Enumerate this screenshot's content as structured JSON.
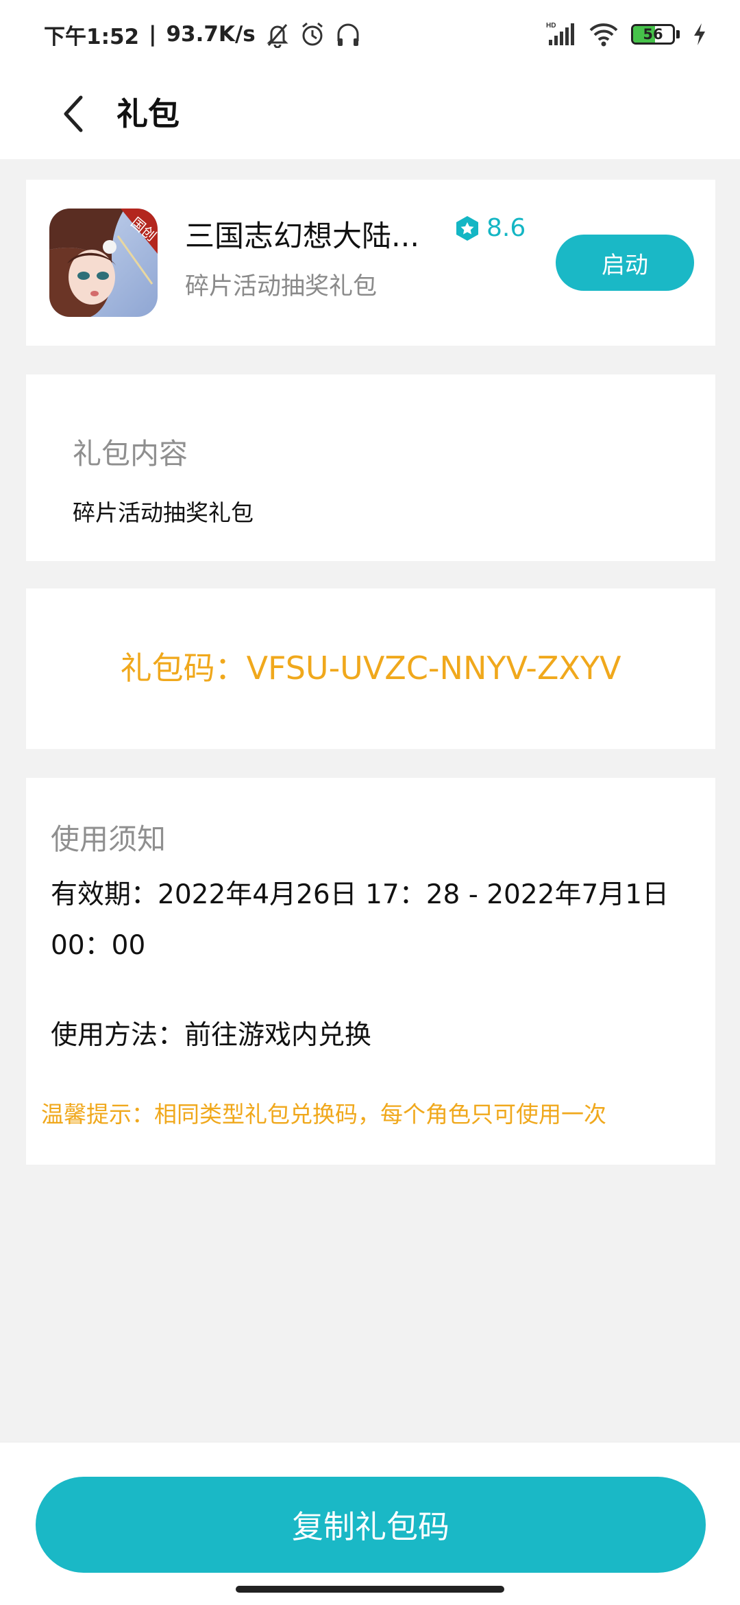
{
  "status_bar": {
    "time": "下午1:52",
    "divider": "|",
    "net_speed": "93.7K/s",
    "signal_label": "HD",
    "battery_level": "56",
    "battery_fraction": 0.56
  },
  "header": {
    "title": "礼包"
  },
  "game": {
    "icon_badge": "国创",
    "name": "三国志幻想大陆...",
    "rating": "8.6",
    "subtitle": "碎片活动抽奖礼包",
    "launch_label": "启动"
  },
  "content": {
    "title": "礼包内容",
    "text": "碎片活动抽奖礼包"
  },
  "code": {
    "text": "礼包码：VFSU-UVZC-NNYV-ZXYV"
  },
  "usage": {
    "title": "使用须知",
    "validity": "有效期：2022年4月26日 17：28 - 2022年7月1日 00：00",
    "method": "使用方法：前往游戏内兑换",
    "tip": "温馨提示：相同类型礼包兑换码，每个角色只可使用一次"
  },
  "footer": {
    "copy_label": "复制礼包码"
  },
  "colors": {
    "accent": "#1ab8c6",
    "highlight": "#f0a81c",
    "background": "#f2f2f2"
  }
}
